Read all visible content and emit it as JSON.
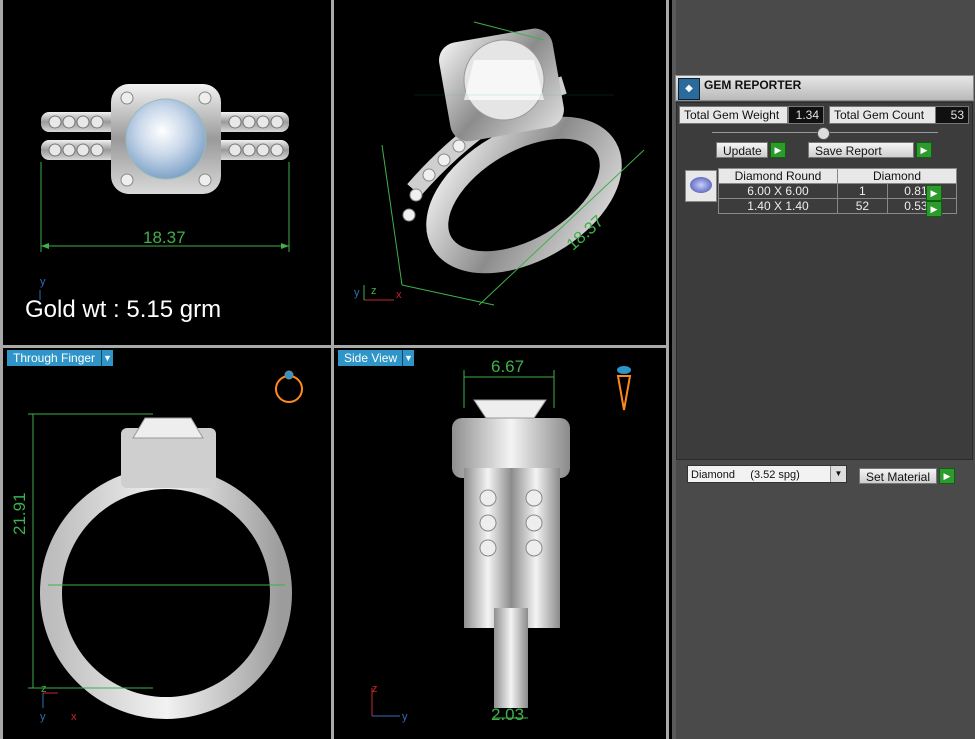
{
  "viewports": {
    "top_left": {
      "dimension": "18.37",
      "gold_label": "Gold wt : 5.15 grm",
      "axis": [
        "y"
      ]
    },
    "top_right": {
      "dimension": "18.37",
      "axis": [
        "y",
        "z",
        "x"
      ]
    },
    "bottom_left": {
      "label": "Through Finger",
      "dimension": "21.91",
      "axis": [
        "z",
        "y",
        "x"
      ]
    },
    "bottom_right": {
      "label": "Side View",
      "dimension_top": "6.67",
      "dimension_bottom": "2.03",
      "axis": [
        "z",
        "y"
      ]
    }
  },
  "gem_reporter": {
    "title": "GEM REPORTER",
    "total_weight_label": "Total Gem Weight",
    "total_weight_value": "1.34",
    "total_count_label": "Total Gem Count",
    "total_count_value": "53",
    "update_label": "Update",
    "save_report_label": "Save Report",
    "table": {
      "headers": [
        "Diamond Round",
        "Diamond"
      ],
      "rows": [
        {
          "size": "6.00 X 6.00",
          "count": "1",
          "weight": "0.81tw"
        },
        {
          "size": "1.40 X 1.40",
          "count": "52",
          "weight": "0.53tw"
        }
      ]
    },
    "material_select": "Diamond     (3.52 spg)",
    "set_material_label": "Set Material"
  },
  "colors": {
    "dimension_green": "#3fb04a",
    "viewport_label_blue": "#2f95c8",
    "button_green": "#2c9a2c"
  }
}
